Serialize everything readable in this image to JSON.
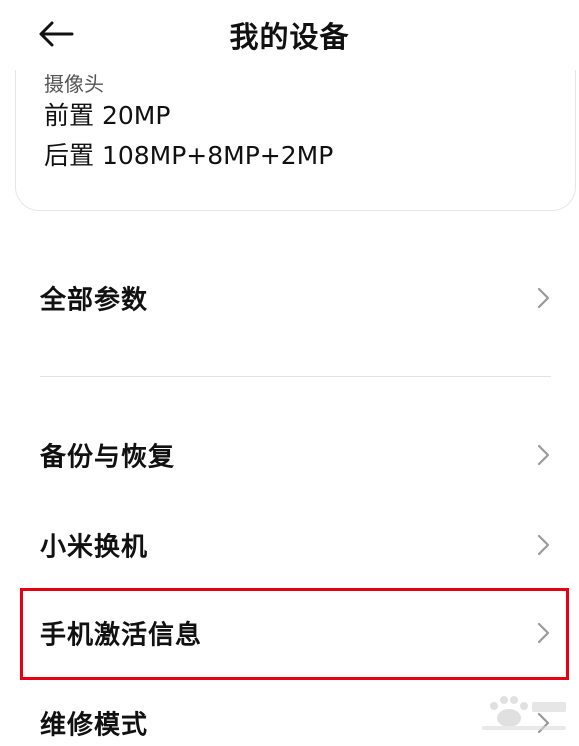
{
  "header": {
    "title": "我的设备",
    "back_icon": "arrow-left-icon"
  },
  "device_info": {
    "camera_label": "摄像头",
    "front_camera": "前置 20MP",
    "rear_camera": "后置 108MP+8MP+2MP"
  },
  "menu": {
    "all_params": "全部参数",
    "backup_restore": "备份与恢复",
    "mi_mover": "小米换机",
    "activation_info": "手机激活信息",
    "repair_mode": "维修模式",
    "chevron_icon": "chevron-right-icon"
  },
  "colors": {
    "highlight": "#e60012",
    "divider": "#e3e3e3",
    "chevron": "#9a9a9a"
  }
}
